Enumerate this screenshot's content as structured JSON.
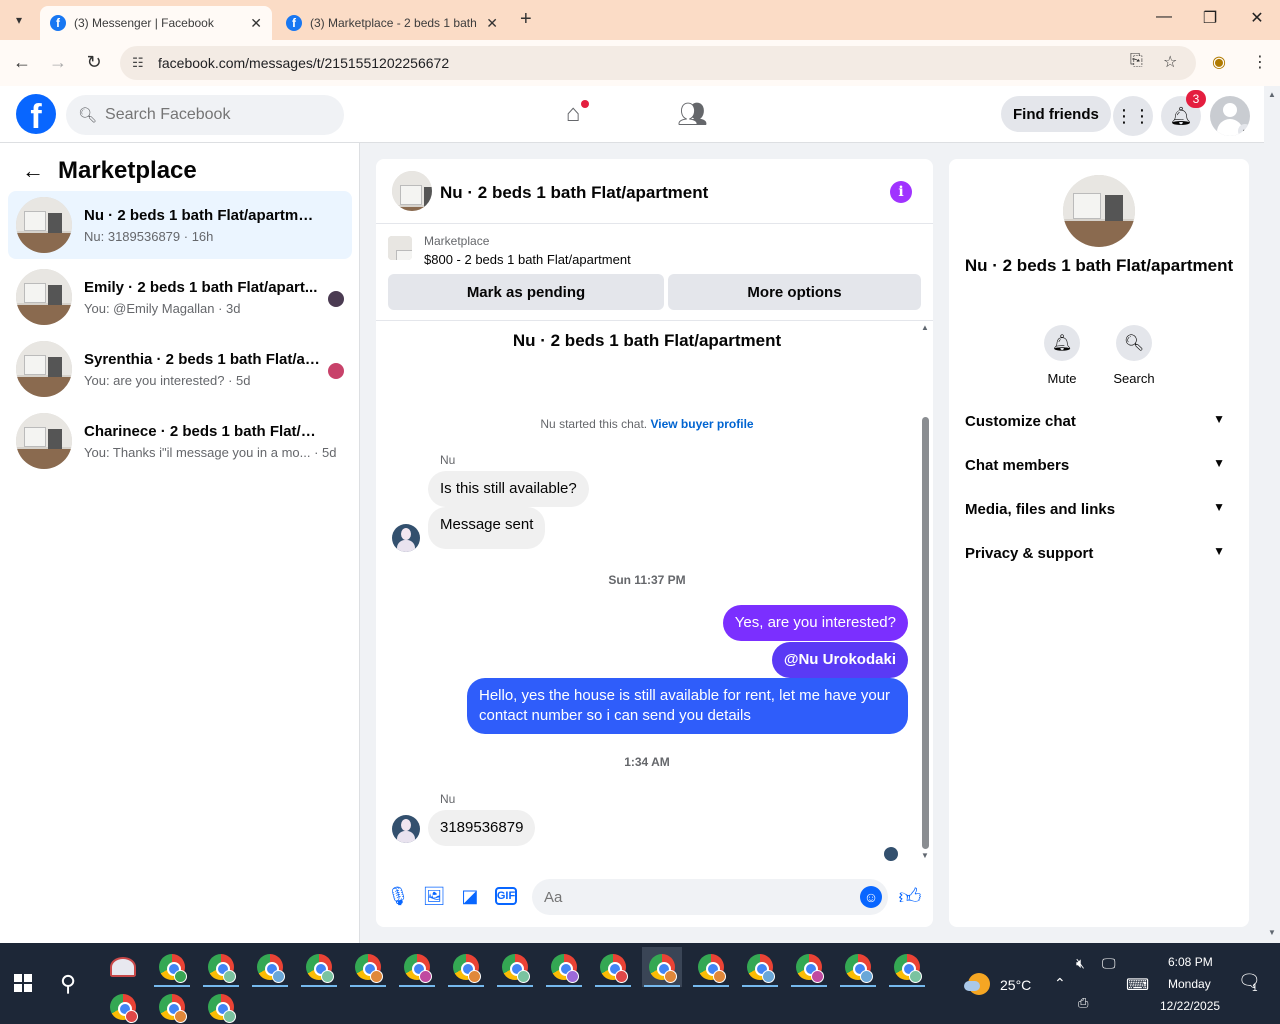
{
  "browser": {
    "tabs": [
      {
        "label": "(3) Messenger | Facebook",
        "active": true
      },
      {
        "label": "(3) Marketplace - 2 beds 1 bath",
        "active": false
      }
    ],
    "url": "facebook.com/messages/t/2151551202256672"
  },
  "fb_header": {
    "search_placeholder": "Search Facebook",
    "find_friends_label": "Find friends",
    "notifications_count": "3"
  },
  "sidebar": {
    "title": "Marketplace",
    "conversations": [
      {
        "name": "Nu · 2 beds 1 bath Flat/apartment",
        "preview": "Nu: 3189536879 · 16h",
        "active": true
      },
      {
        "name": "Emily · 2 beds 1 bath Flat/apart...",
        "preview": "You: @Emily Magallan · 3d",
        "active": false,
        "avatar_color": "#4b3b52"
      },
      {
        "name": "Syrenthia · 2 beds 1 bath Flat/ap...",
        "preview": "You: are you interested? · 5d",
        "active": false,
        "avatar_color": "#c8426a"
      },
      {
        "name": "Charinece · 2 beds 1 bath Flat/apar...",
        "preview": "You: Thanks i\"il message you in a mo... · 5d",
        "active": false
      }
    ]
  },
  "chat": {
    "header_title": "Nu · 2 beds 1 bath Flat/apartment",
    "marketplace_label": "Marketplace",
    "listing": "$800 - 2 beds 1 bath Flat/apartment",
    "mark_pending_label": "Mark as pending",
    "more_options_label": "More options",
    "intro_title": "Nu · 2 beds 1 bath Flat/apartment",
    "started_text": "Nu started this chat.",
    "view_buyer_profile": "View buyer profile",
    "sender_name": "Nu",
    "msg_in_1": "Is this still available?",
    "msg_in_2": "Message sent",
    "timestamp_1": "Sun 11:37 PM",
    "msg_out_1": "Yes, are you interested?",
    "msg_out_2": "@Nu Urokodaki",
    "msg_out_3_line1": "Hello, yes the house is still available for rent, let me have your",
    "msg_out_3_line2": "contact number so i can send you details",
    "timestamp_2": "1:34 AM",
    "sender_name_2": "Nu",
    "msg_in_3": "3189536879",
    "composer_placeholder": "Aa",
    "colors": {
      "out_bubble_top": "#a033ff",
      "out_bubble_bottom": "#1d5fff",
      "accent": "#0866ff"
    }
  },
  "info_panel": {
    "name": "Nu · 2 beds 1 bath Flat/apartment",
    "mute_label": "Mute",
    "search_label": "Search",
    "sections": [
      "Customize chat",
      "Chat members",
      "Media, files and links",
      "Privacy & support"
    ]
  },
  "taskbar": {
    "temperature": "25°C",
    "time": "6:08 PM",
    "day": "Monday",
    "date": "12/22/2025",
    "notification_count": "1",
    "profile_badge_colors": [
      "#3aa655",
      "#7ac3a0",
      "#6aa7d8",
      "#7ac3a0",
      "#e0883a",
      "#c04aa0",
      "#e0883a",
      "#7ac3a0",
      "#9c6ad8",
      "#e04848",
      "#e0883a",
      "#e0883a",
      "#6aa7d8",
      "#c04aa0",
      "#6aa7d8",
      "#7ac3a0"
    ],
    "second_row_badge_colors": [
      "#e04848",
      "#e0883a",
      "#7ac3a0"
    ]
  }
}
